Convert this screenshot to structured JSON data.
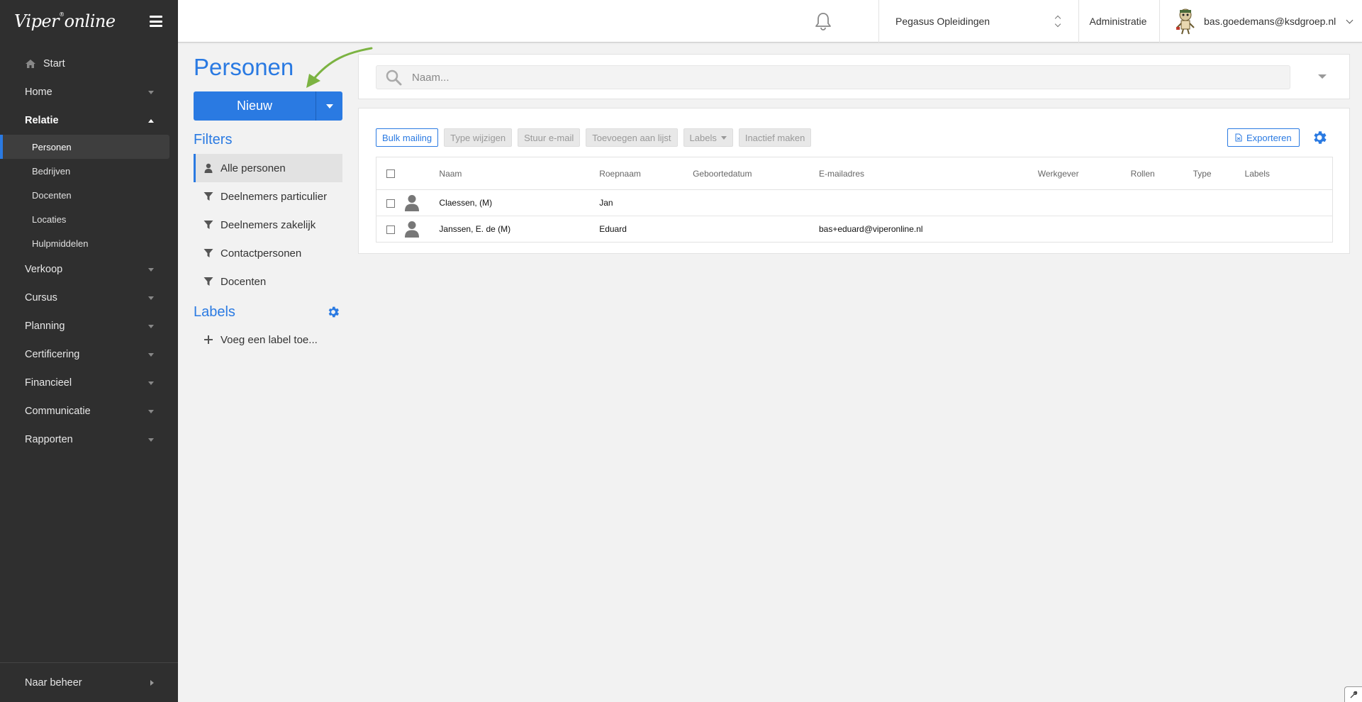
{
  "sidebar": {
    "logo": "Viper",
    "logo_mark": "®",
    "logo_suffix": "online",
    "start": "Start",
    "items": [
      {
        "label": "Home"
      },
      {
        "label": "Relatie"
      },
      {
        "label": "Verkoop"
      },
      {
        "label": "Cursus"
      },
      {
        "label": "Planning"
      },
      {
        "label": "Certificering"
      },
      {
        "label": "Financieel"
      },
      {
        "label": "Communicatie"
      },
      {
        "label": "Rapporten"
      }
    ],
    "sub_items": [
      {
        "label": "Personen"
      },
      {
        "label": "Bedrijven"
      },
      {
        "label": "Docenten"
      },
      {
        "label": "Locaties"
      },
      {
        "label": "Hulpmiddelen"
      }
    ],
    "footer": "Naar beheer"
  },
  "topbar": {
    "organization": "Pegasus Opleidingen",
    "admin": "Administratie",
    "user": "bas.goedemans@ksdgroep.nl"
  },
  "page": {
    "title": "Personen",
    "new_button": "Nieuw",
    "filters_heading": "Filters",
    "filters": [
      {
        "label": "Alle personen",
        "icon": "person-icon"
      },
      {
        "label": "Deelnemers particulier",
        "icon": "filter-icon"
      },
      {
        "label": "Deelnemers zakelijk",
        "icon": "filter-icon"
      },
      {
        "label": "Contactpersonen",
        "icon": "filter-icon"
      },
      {
        "label": "Docenten",
        "icon": "filter-icon"
      }
    ],
    "labels_heading": "Labels",
    "add_label": "Voeg een label toe..."
  },
  "search": {
    "placeholder": "Naam..."
  },
  "table": {
    "actions": {
      "bulk_mailing": "Bulk mailing",
      "type_wijzigen": "Type wijzigen",
      "stuur_email": "Stuur e-mail",
      "toevoegen": "Toevoegen aan lijst",
      "labels": "Labels",
      "inactief": "Inactief maken"
    },
    "export": "Exporteren",
    "columns": [
      "Naam",
      "Roepnaam",
      "Geboortedatum",
      "E-mailadres",
      "Werkgever",
      "Rollen",
      "Type",
      "Labels"
    ],
    "rows": [
      {
        "naam": "Claessen, (M)",
        "roepnaam": "Jan",
        "geboortedatum": "",
        "email": "",
        "werkgever": "",
        "rollen": "",
        "type": "",
        "labels": ""
      },
      {
        "naam": "Janssen, E. de (M)",
        "roepnaam": "Eduard",
        "geboortedatum": "",
        "email": "bas+eduard@viperonline.nl",
        "werkgever": "",
        "rollen": "",
        "type": "",
        "labels": ""
      }
    ]
  },
  "colors": {
    "accent": "#2a7ae2",
    "sidebar_bg": "#2f2f2f",
    "annotation_arrow": "#7cb342"
  }
}
